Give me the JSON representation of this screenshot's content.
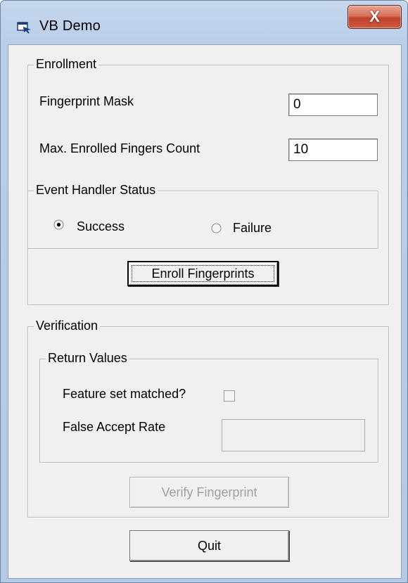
{
  "window": {
    "title": "VB Demo",
    "close_glyph": "X",
    "icon": "app-window-icon"
  },
  "enrollment": {
    "legend": "Enrollment",
    "fingerprint_mask_label": "Fingerprint Mask",
    "fingerprint_mask_value": "0",
    "max_enrolled_label": "Max. Enrolled Fingers Count",
    "max_enrolled_value": "10",
    "event_handler": {
      "legend": "Event Handler Status",
      "success_label": "Success",
      "failure_label": "Failure",
      "selected": "Success"
    },
    "enroll_button": "Enroll Fingerprints"
  },
  "verification": {
    "legend": "Verification",
    "return_values": {
      "legend": "Return Values",
      "feature_matched_label": "Feature set matched?",
      "feature_matched_checked": false,
      "far_label": "False Accept Rate",
      "far_value": ""
    },
    "verify_button": "Verify Fingerprint"
  },
  "quit_button": "Quit"
}
